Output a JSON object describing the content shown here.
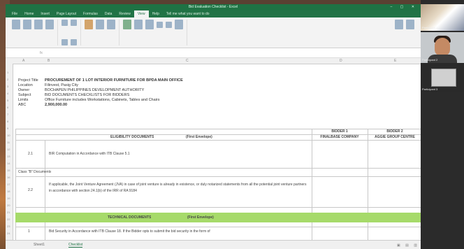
{
  "window": {
    "title": "Bid Evaluation Checklist - Excel"
  },
  "menu_tabs": [
    "File",
    "Home",
    "Insert",
    "Page Layout",
    "Formulas",
    "Data",
    "Review",
    "View",
    "Help",
    "Tell me what you want to do"
  ],
  "active_menu_tab": "View",
  "project_info": [
    {
      "label": "Project Title",
      "value": "PROCUREMENT OF 1 LOT INTERIOR FURNITURE FOR BPDA MAIN OFFICE",
      "bold": true
    },
    {
      "label": "Location",
      "value": "Filinvest, Pasig City",
      "bold": false
    },
    {
      "label": "Owner",
      "value": "BOCHAPEN PHILIPPINES DEVELOPMENT AUTHORITY",
      "bold": false
    },
    {
      "label": "Subject",
      "value": "BID DOCUMENTS CHECKLISTS FOR BIDDERS",
      "bold": false
    },
    {
      "label": "Limits",
      "value": "Office Furniture includes Workstations, Cabinets, Tables and Chairs",
      "bold": false
    },
    {
      "label": "ABC",
      "value": "2,900,000.00",
      "bold": true
    }
  ],
  "bidders": {
    "b1_label": "BIDDER 1",
    "b1_name": "FINALBASE COMPANY",
    "b2_label": "BIDDER 2",
    "b2_name": "AGGIE GROUP CENTRE"
  },
  "eligibility": {
    "header": "ELIGIBILITY DOCUMENTS",
    "subheader": "(First Envelope)",
    "rows": [
      {
        "num": "2.1",
        "text": "BIR Computation in Accordance with ITB Clause 5.1"
      },
      {
        "num": "2.2",
        "text": "If applicable, the Joint Venture Agreement (JVA) in case of joint venture is already in existence, or duly notarized statements from all the potential joint venture partners in accordance with section 24.1(b) of the IRR of RA 9184"
      }
    ],
    "class_b_label": "Class \"B\" Documents"
  },
  "technical": {
    "header": "TECHNICAL DOCUMENTS",
    "subheader": "(First Envelope)",
    "rows": [
      {
        "num": "1",
        "text": "Bid Security in Accordance with ITB Clause 18. If the Bidder opts to submit the bid security in the form of"
      }
    ]
  },
  "sheet_tabs": [
    "Sheet1",
    "Checklist"
  ],
  "active_sheet": "Checklist",
  "video_participants": [
    "Participant 1",
    "Participant 2",
    "Participant 3"
  ]
}
